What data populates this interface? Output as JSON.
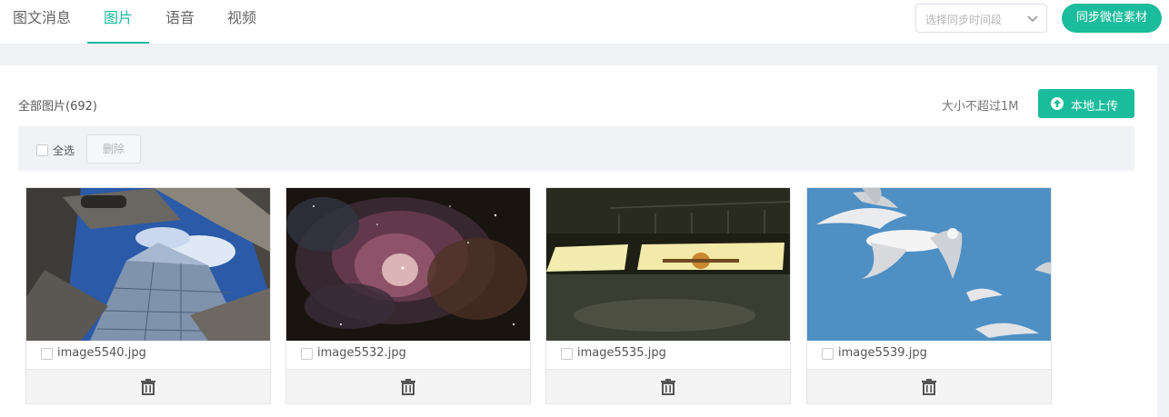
{
  "tabs": [
    {
      "label": "图文消息"
    },
    {
      "label": "图片"
    },
    {
      "label": "语音"
    },
    {
      "label": "视频"
    }
  ],
  "active_tab": "图片",
  "sync": {
    "select_placeholder": "选择同步时间段",
    "button_label": "同步微信素材"
  },
  "library": {
    "all_label": "全部图片(692)",
    "size_note": "大小不超过1M",
    "upload_label": "本地上传",
    "select_all_label": "全选",
    "delete_label": "删除"
  },
  "images": [
    {
      "name": "image5540.jpg"
    },
    {
      "name": "image5532.jpg"
    },
    {
      "name": "image5535.jpg"
    },
    {
      "name": "image5539.jpg"
    }
  ],
  "colors": {
    "accent": "#1bbc9b",
    "page_bg": "#f0f2f5"
  },
  "icons": [
    "chevron-down-icon",
    "upload-icon",
    "trash-icon"
  ]
}
